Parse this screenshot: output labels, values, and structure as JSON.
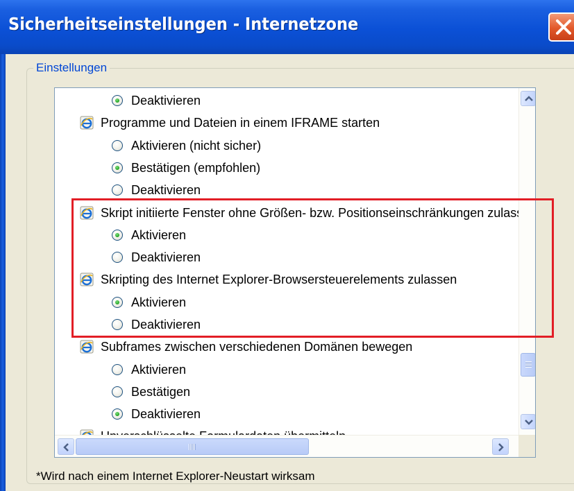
{
  "window": {
    "title": "Sicherheitseinstellungen - Internetzone"
  },
  "group": {
    "label": "Einstellungen"
  },
  "settings": [
    {
      "kind": "option",
      "label": "Deaktivieren",
      "checked": true
    },
    {
      "kind": "heading",
      "label": "Programme und Dateien in einem IFRAME starten",
      "icon": "ie-icon"
    },
    {
      "kind": "option",
      "label": "Aktivieren (nicht sicher)",
      "checked": false
    },
    {
      "kind": "option",
      "label": "Bestätigen (empfohlen)",
      "checked": true
    },
    {
      "kind": "option",
      "label": "Deaktivieren",
      "checked": false
    },
    {
      "kind": "heading",
      "label": "Skript initiierte Fenster ohne Größen- bzw. Positionseinschränkungen zulassen",
      "icon": "ie-icon"
    },
    {
      "kind": "option",
      "label": "Aktivieren",
      "checked": true
    },
    {
      "kind": "option",
      "label": "Deaktivieren",
      "checked": false
    },
    {
      "kind": "heading",
      "label": "Skripting des Internet Explorer-Browsersteuerelements zulassen",
      "icon": "ie-icon"
    },
    {
      "kind": "option",
      "label": "Aktivieren",
      "checked": true
    },
    {
      "kind": "option",
      "label": "Deaktivieren",
      "checked": false
    },
    {
      "kind": "heading",
      "label": "Subframes zwischen verschiedenen Domänen bewegen",
      "icon": "ie-icon"
    },
    {
      "kind": "option",
      "label": "Aktivieren",
      "checked": false
    },
    {
      "kind": "option",
      "label": "Bestätigen",
      "checked": false
    },
    {
      "kind": "option",
      "label": "Deaktivieren",
      "checked": true
    },
    {
      "kind": "heading",
      "label": "Unverschlüsselte Formulardaten übermitteln",
      "icon": "ie-icon"
    }
  ],
  "footnote": "*Wird nach einem Internet Explorer-Neustart wirksam",
  "colors": {
    "titlebar": "#0a4bc9",
    "highlight": "#e21e26",
    "group_label": "#0046d5",
    "dialog_bg": "#ece9d8"
  }
}
